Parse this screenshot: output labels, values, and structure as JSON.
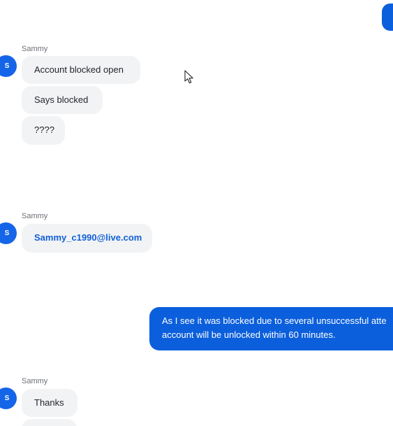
{
  "chat": {
    "sender_name": "Sammy",
    "avatar_initial": "S",
    "group1": {
      "messages": [
        "Account blocked open",
        "Says blocked",
        "????"
      ]
    },
    "group2": {
      "messages": [
        "Sammy_c1990@live.com"
      ]
    },
    "outgoing": {
      "line1": "As I see it was blocked due to several unsuccessful atte",
      "line2": "account will be unlocked within 60 minutes."
    },
    "group3": {
      "messages": [
        "Thanks"
      ]
    }
  },
  "colors": {
    "outgoing_bubble": "#0b5fdc",
    "incoming_bubble": "#f2f3f5",
    "avatar": "#1565e8",
    "link_text": "#1160d6"
  },
  "icons": {
    "cursor": "mouse-pointer-icon"
  }
}
